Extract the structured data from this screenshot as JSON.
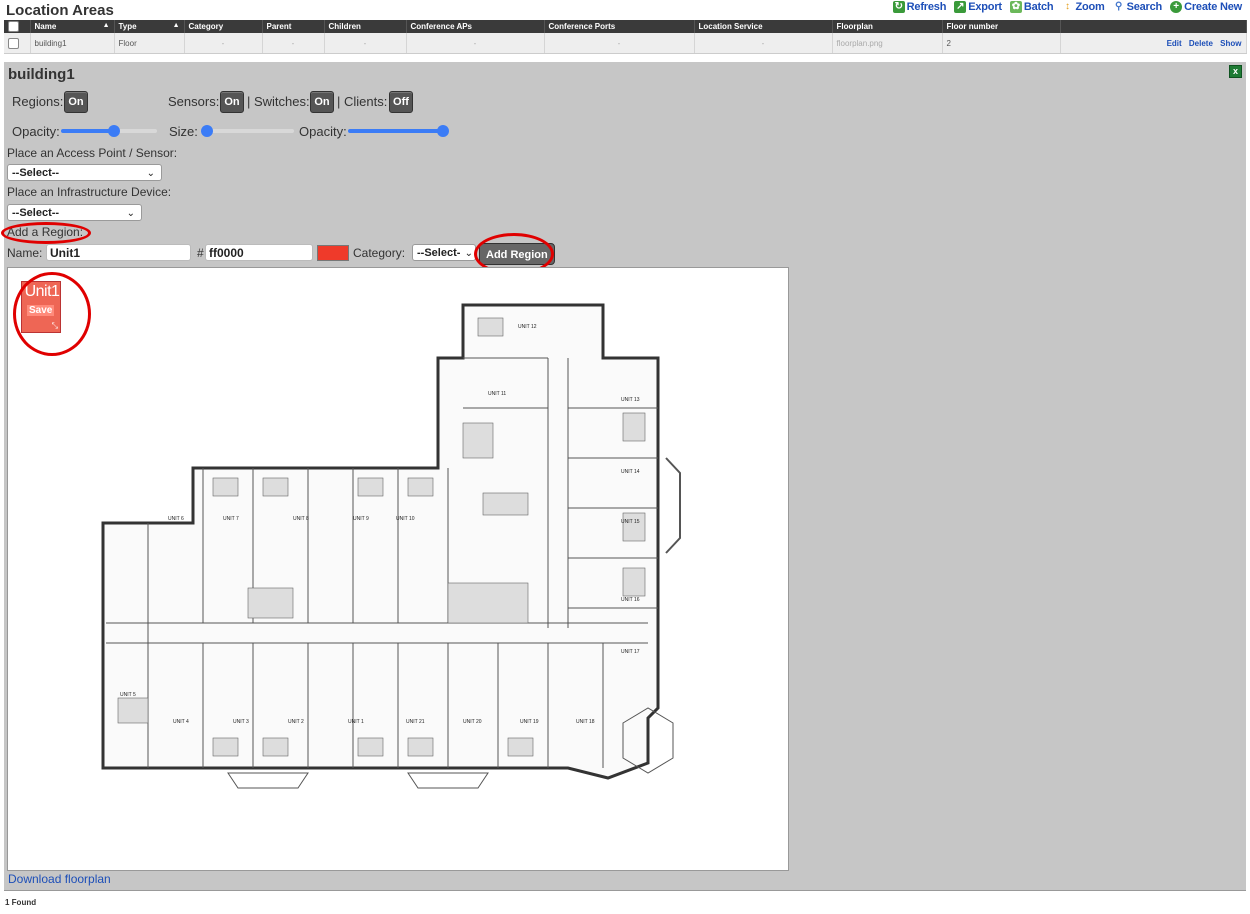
{
  "header": {
    "title": "Location Areas"
  },
  "toolbar": {
    "refresh": "Refresh",
    "export": "Export",
    "batch": "Batch",
    "zoom": "Zoom",
    "search": "Search",
    "create": "Create New"
  },
  "table": {
    "columns": [
      "Name",
      "Type",
      "Category",
      "Parent",
      "Children",
      "Conference APs",
      "Conference Ports",
      "Location Service",
      "Floorplan",
      "Floor number"
    ],
    "row": {
      "name": "building1",
      "type": "Floor",
      "category": "-",
      "parent": "-",
      "children": "-",
      "conference_aps": "-",
      "conference_ports": "-",
      "location_service": "-",
      "floorplan": "floorplan.png",
      "floor_number": "2",
      "actions": [
        "Edit",
        "Delete",
        "Show"
      ]
    }
  },
  "detail": {
    "title": "building1",
    "regions_label": "Regions:",
    "regions_state": "On",
    "sensors_label": "Sensors:",
    "sensors_state": "On",
    "switches_label": "| Switches:",
    "switches_state": "On",
    "clients_label": "| Clients:",
    "clients_state": "Off",
    "opacity_label": "Opacity:",
    "size_label": "Size:",
    "opacity2_label": "Opacity:",
    "sliders": {
      "opacity": 0.55,
      "size": 0.05,
      "opacity2": 0.95
    },
    "ap_label": "Place an Access Point / Sensor:",
    "ap_select": "--Select--",
    "infra_label": "Place an Infrastructure Device:",
    "infra_select": "--Select--",
    "add_region_label": "Add a Region:",
    "name_label": "Name:",
    "name_value": "Unit1",
    "hash": "#",
    "color_value": "ff0000",
    "category_label": "Category:",
    "category_select": "--Select--",
    "add_region_button": "Add Region",
    "region": {
      "name": "Unit1",
      "save": "Save"
    },
    "download_link": "Download floorplan"
  },
  "footer": {
    "count": "1 Found"
  },
  "floorplan_units": [
    "UNIT 12",
    "UNIT 11",
    "UNIT 13",
    "UNIT 14",
    "UNIT 15",
    "UNIT 16",
    "UNIT 17",
    "UNIT 6",
    "UNIT 7",
    "UNIT 8",
    "UNIT 9",
    "UNIT 10",
    "UNIT 5",
    "UNIT 4",
    "UNIT 3",
    "UNIT 2",
    "UNIT 1",
    "UNIT 21",
    "UNIT 20",
    "UNIT 19",
    "UNIT 18"
  ],
  "colors": {
    "accent": "#3b7cf6",
    "region": "#ee6655",
    "highlight": "#e00000"
  }
}
